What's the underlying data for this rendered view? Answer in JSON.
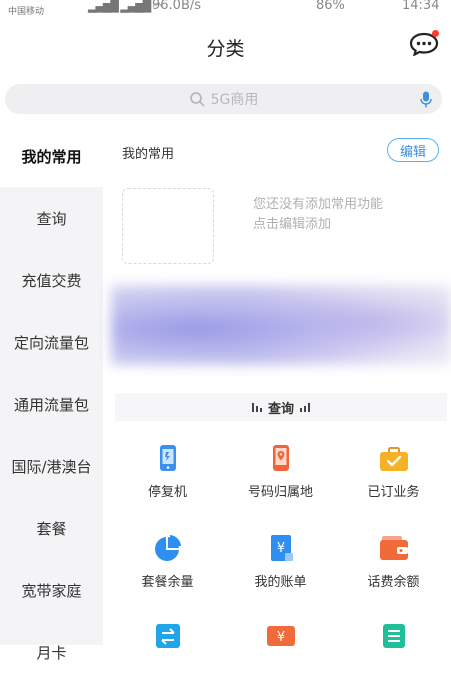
{
  "status_bar": {
    "carrier": "中国移动",
    "speed": "96.0B/s",
    "battery": "86%",
    "time": "14:34"
  },
  "header": {
    "title": "分类"
  },
  "search": {
    "placeholder": "5G商用"
  },
  "sidebar": {
    "items": [
      {
        "label": "我的常用",
        "active": true
      },
      {
        "label": "查询"
      },
      {
        "label": "充值交费"
      },
      {
        "label": "定向流量包"
      },
      {
        "label": "通用流量包"
      },
      {
        "label": "国际/港澳台"
      },
      {
        "label": "套餐"
      },
      {
        "label": "宽带家庭"
      },
      {
        "label": "月卡"
      }
    ]
  },
  "main": {
    "section_title": "我的常用",
    "edit_label": "编辑",
    "empty_line1": "您还没有添加常用功能",
    "empty_line2": "点击编辑添加",
    "query_section_title": "查询",
    "grid": [
      {
        "label": "停复机",
        "icon": "phone-icon",
        "color": "#3a8ff0"
      },
      {
        "label": "号码归属地",
        "icon": "location-phone-icon",
        "color": "#f0643a"
      },
      {
        "label": "已订业务",
        "icon": "briefcase-check-icon",
        "color": "#f6b126"
      },
      {
        "label": "套餐余量",
        "icon": "pie-chart-icon",
        "color": "#2d8ff0"
      },
      {
        "label": "我的账单",
        "icon": "yuan-bill-icon",
        "color": "#2e8ff0"
      },
      {
        "label": "话费余额",
        "icon": "wallet-icon",
        "color": "#f06a3a"
      },
      {
        "label": "",
        "icon": "transfer-icon",
        "color": "#1fa5e8"
      },
      {
        "label": "",
        "icon": "yuan-ticket-icon",
        "color": "#f06a3a"
      },
      {
        "label": "",
        "icon": "list-icon",
        "color": "#1fbf9a"
      }
    ]
  },
  "colors": {
    "accent_blue": "#3d8fe0",
    "sidebar_bg": "#f4f4f6",
    "badge_red": "#ff3b30"
  }
}
